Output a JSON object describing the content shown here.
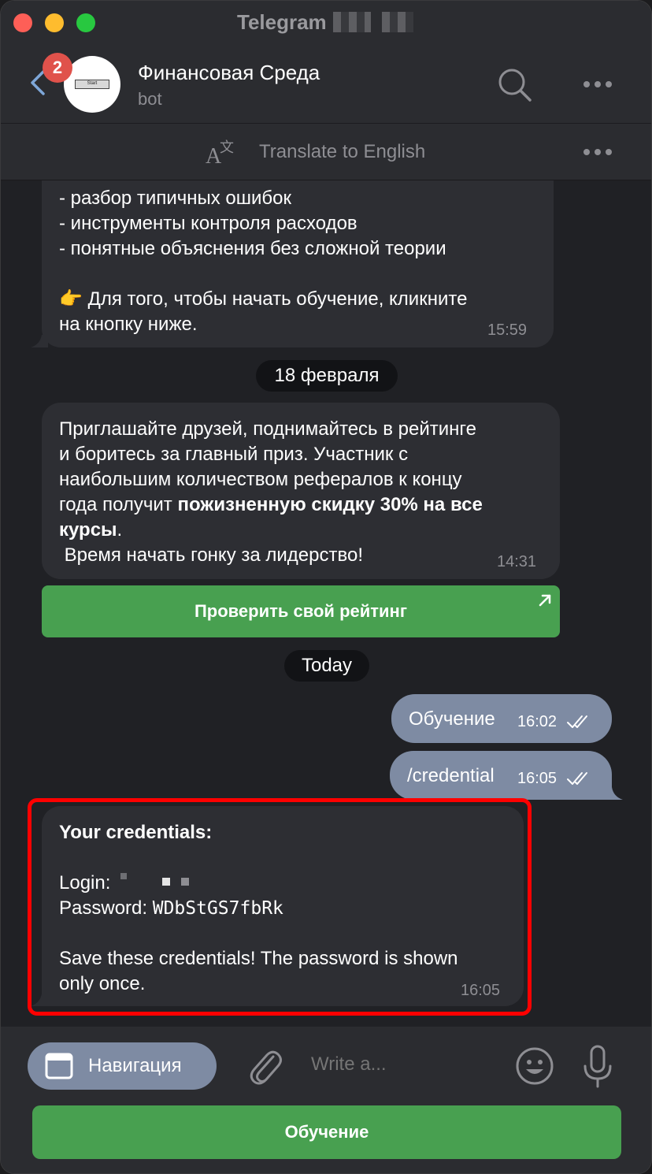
{
  "window": {
    "title": "Telegram"
  },
  "header": {
    "unread_count": "2",
    "chat_name": "Финансовая Среда",
    "chat_subtitle": "bot",
    "avatar_text": "Start"
  },
  "translate_bar": {
    "label": "Translate to English"
  },
  "messages": {
    "m1": {
      "lines": [
        "- разбор типичных ошибок",
        "- инструменты контроля расходов",
        "- понятные объяснения без сложной теории"
      ],
      "cta_emoji": "👉",
      "cta_text_1": "Для того, чтобы начать обучение, кликните",
      "cta_text_2": "на кнопку ниже.",
      "time": "15:59"
    },
    "date1": "18 февраля",
    "m2": {
      "line1": "Приглашайте друзей, поднимайтесь в рейтинге",
      "line2": "и боритесь за главный приз. Участник с",
      "line3": "наибольшим количеством рефералов к концу",
      "line4_plain": "года получит ",
      "line4_bold": "пожизненную скидку 30% на все",
      "line5_bold": "курсы",
      "line5_plain": ".",
      "line6": " Время начать гонку за лидерство!",
      "time": "14:31",
      "button_label": "Проверить свой рейтинг"
    },
    "date2": "Today",
    "out1": {
      "text": "Обучение",
      "time": "16:02"
    },
    "out2": {
      "text": "/credential",
      "time": "16:05"
    },
    "m3": {
      "title": "Your credentials:",
      "login_label": "Login:",
      "password_label": "Password:",
      "password_value": "WDbStGS7fbRk",
      "note_1": "Save these credentials! The password is shown",
      "note_2": "only once.",
      "time": "16:05"
    }
  },
  "composer": {
    "nav_label": "Навигация",
    "placeholder": "Write a...",
    "bottom_button": "Обучение"
  },
  "colors": {
    "accent_green": "#48a050",
    "outgoing_bubble": "#7e8ba3",
    "highlight_red": "#ff0000",
    "badge_red": "#e0524b"
  }
}
